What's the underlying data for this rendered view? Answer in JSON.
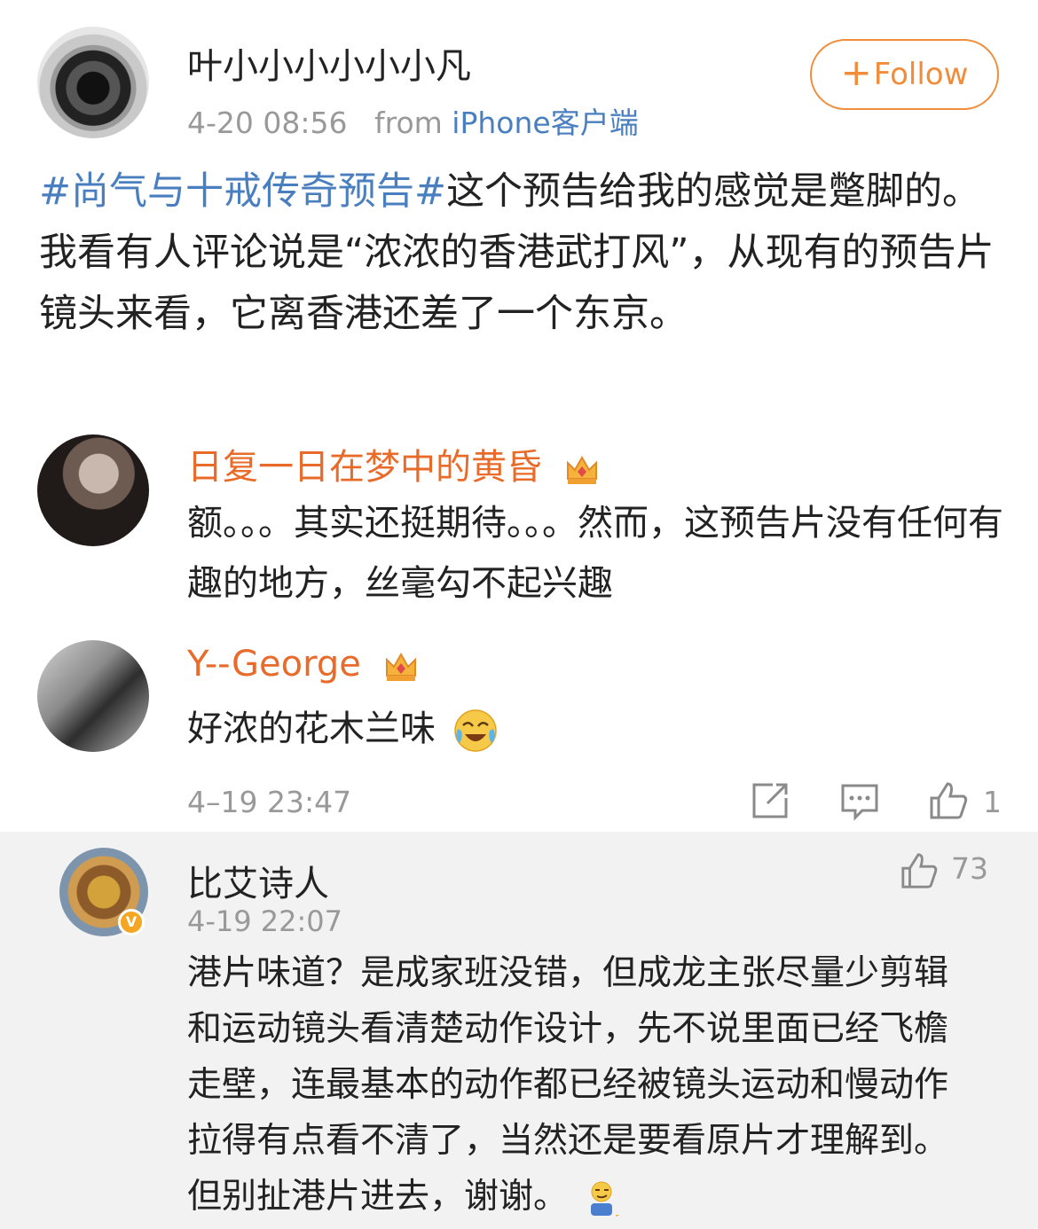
{
  "post": {
    "author": "叶小小小小小小凡",
    "time": "4-20 08:56",
    "from_label": "from",
    "source": "iPhone客户端",
    "follow_label": "Follow",
    "hashtag": "#尚气与十戒传奇预告#",
    "text": "这个预告给我的感觉是蹩脚的。我看有人评论说是“浓浓的香港武打风”，从现有的预告片镜头来看，它离香港还差了一个东京。"
  },
  "comments": [
    {
      "name": "日复一日在梦中的黄昏",
      "text": "额。。。其实还挺期待。。。然而，这预告片没有任何有趣的地方，丝毫勾不起兴趣",
      "badge_icon": "crown-icon"
    },
    {
      "name": "Y--George",
      "text": "好浓的花木兰味",
      "badge_icon": "crown-icon",
      "emoji_icon": "laugh-cry-icon"
    }
  ],
  "comment_footer": {
    "time": "4–19 23:47",
    "like_count": "1"
  },
  "reply": {
    "name": "比艾诗人",
    "time": "4-19 22:07",
    "like_count": "73",
    "text": "港片味道？是成家班没错，但成龙主张尽量少剪辑和运动镜头看清楚动作设计，先不说里面已经飞檐走壁，连最基本的动作都已经被镜头运动和慢动作拉得有点看不清了，当然还是要看原片才理解到。但别扯港片进去，谢谢。",
    "verified_badge": "V"
  },
  "colors": {
    "link_blue": "#4a7fbf",
    "orange": "#e86b2a",
    "follow": "#f08c3a",
    "meta_gray": "#999999",
    "reply_bg": "#f2f2f2"
  }
}
